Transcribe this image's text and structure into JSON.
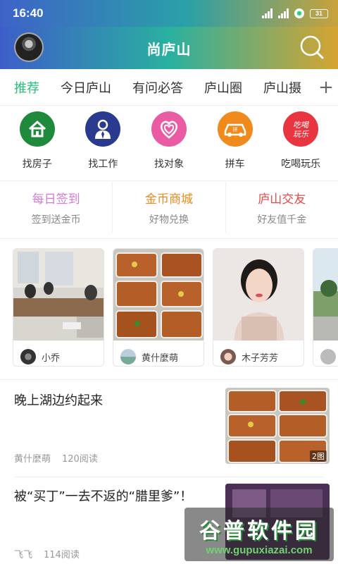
{
  "status_bar": {
    "time": "16:40",
    "battery": "31"
  },
  "header": {
    "title": "尚庐山",
    "accent": "#2bbf7a"
  },
  "tabs": [
    {
      "label": "推荐",
      "active": true
    },
    {
      "label": "今日庐山"
    },
    {
      "label": "有问必答"
    },
    {
      "label": "庐山圈"
    },
    {
      "label": "庐山摄"
    }
  ],
  "tabs_add_icon": "plus-icon",
  "shortcuts": [
    {
      "label": "找房子",
      "icon": "house-icon",
      "color": "#1f8a3c"
    },
    {
      "label": "找工作",
      "icon": "worker-icon",
      "color": "#2a3a8f"
    },
    {
      "label": "找对象",
      "icon": "hearts-icon",
      "color": "#e95ca4"
    },
    {
      "label": "拼车",
      "icon": "car-icon",
      "color": "#f08a1c"
    },
    {
      "label": "吃喝玩乐",
      "icon": "food-fun-icon",
      "color": "#e8353f"
    }
  ],
  "promos": [
    {
      "title": "每日签到",
      "subtitle": "签到送金币",
      "color": "#d77ad6"
    },
    {
      "title": "金币商城",
      "subtitle": "好物兑换",
      "color": "#ef8a1a"
    },
    {
      "title": "庐山交友",
      "subtitle": "好友值千金",
      "color": "#e8474a"
    }
  ],
  "cards": [
    {
      "name": "小乔",
      "image": "meeting-photo"
    },
    {
      "name": "黄什麼萌",
      "image": "braised-chicken-feet"
    },
    {
      "name": "木子芳芳",
      "image": "girl-portrait"
    },
    {
      "name": "",
      "image": "outdoor-photo"
    }
  ],
  "articles": [
    {
      "title": "晚上湖边约起来",
      "author": "黄什麼萌",
      "reads": "120阅读",
      "badge": "2图"
    },
    {
      "title": "被“买丁”一去不返的“腊里爹”！",
      "author": "飞飞",
      "reads": "114阅读"
    }
  ],
  "watermark": {
    "main": "谷普软件园",
    "sub": "www.gupuxiazai.com"
  }
}
